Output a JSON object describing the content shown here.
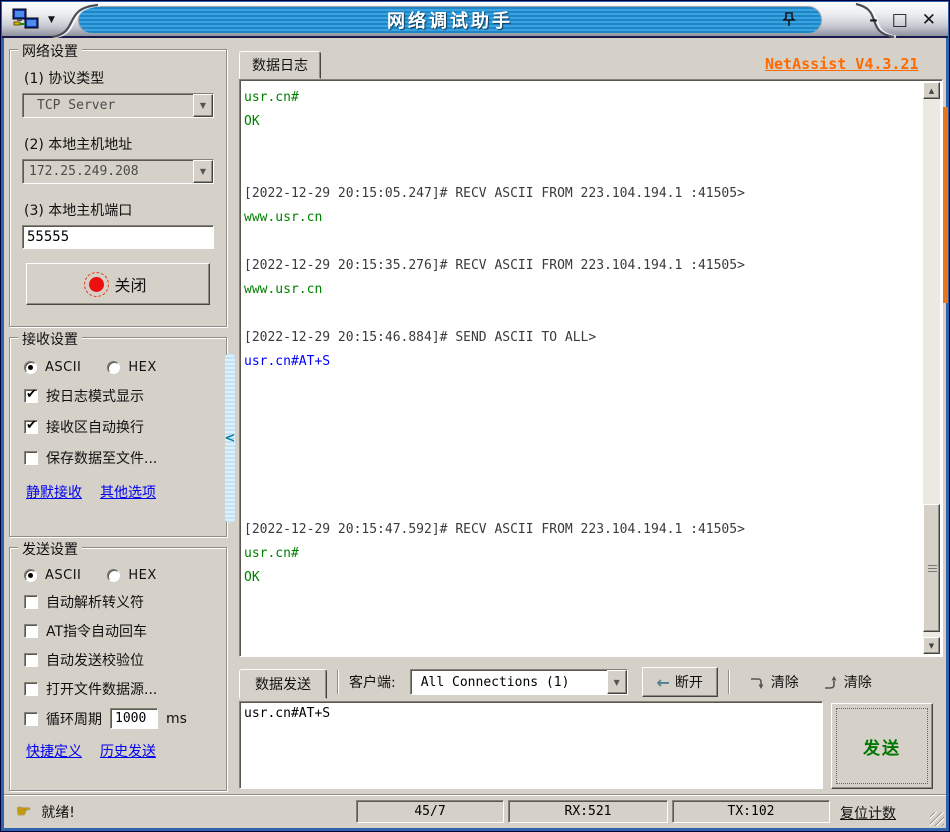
{
  "titlebar": {
    "title": "网络调试助手",
    "minimize": "–",
    "maximize": "□",
    "close": "✕",
    "menu_arrow": "▼"
  },
  "network_settings": {
    "title": "网络设置",
    "protocol_label": "(1) 协议类型",
    "protocol_value": "TCP Server",
    "host_label": "(2) 本地主机地址",
    "host_value": "172.25.249.208",
    "port_label": "(3) 本地主机端口",
    "port_value": "55555",
    "close_button_label": "关闭"
  },
  "receive_settings": {
    "title": "接收设置",
    "ascii_label": "ASCII",
    "hex_label": "HEX",
    "ascii_checked": true,
    "hex_checked": false,
    "options": [
      {
        "label": "按日志模式显示",
        "checked": true
      },
      {
        "label": "接收区自动换行",
        "checked": true
      },
      {
        "label": "保存数据至文件...",
        "checked": false
      }
    ],
    "link1": "静默接收",
    "link2": "其他选项"
  },
  "send_settings": {
    "title": "发送设置",
    "ascii_label": "ASCII",
    "hex_label": "HEX",
    "ascii_checked": true,
    "hex_checked": false,
    "options": [
      {
        "label": "自动解析转义符",
        "checked": false
      },
      {
        "label": "AT指令自动回车",
        "checked": false
      },
      {
        "label": "自动发送校验位",
        "checked": false
      },
      {
        "label": "打开文件数据源...",
        "checked": false
      }
    ],
    "cycle": {
      "label": "循环周期",
      "checked": false,
      "value": "1000",
      "unit": "ms"
    },
    "link1": "快捷定义",
    "link2": "历史发送"
  },
  "log_panel": {
    "tab_label": "数据日志",
    "version_link": "NetAssist V4.3.21",
    "lines": [
      {
        "text": "usr.cn#",
        "type": "recv"
      },
      {
        "text": "OK",
        "type": "recv"
      },
      {
        "text": "",
        "type": "blank"
      },
      {
        "text": "",
        "type": "blank"
      },
      {
        "text": "[2022-12-29 20:15:05.247]# RECV ASCII FROM 223.104.194.1 :41505>",
        "type": "meta"
      },
      {
        "text": "www.usr.cn",
        "type": "recv"
      },
      {
        "text": "",
        "type": "blank"
      },
      {
        "text": "[2022-12-29 20:15:35.276]# RECV ASCII FROM 223.104.194.1 :41505>",
        "type": "meta"
      },
      {
        "text": "www.usr.cn",
        "type": "recv"
      },
      {
        "text": "",
        "type": "blank"
      },
      {
        "text": "[2022-12-29 20:15:46.884]# SEND ASCII TO ALL>",
        "type": "meta"
      },
      {
        "text": "usr.cn#AT+S",
        "type": "send"
      },
      {
        "text": "",
        "type": "blank"
      },
      {
        "text": "",
        "type": "blank"
      },
      {
        "text": "",
        "type": "blank"
      },
      {
        "text": "",
        "type": "blank"
      },
      {
        "text": "",
        "type": "blank"
      },
      {
        "text": "",
        "type": "blank"
      },
      {
        "text": "[2022-12-29 20:15:47.592]# RECV ASCII FROM 223.104.194.1 :41505>",
        "type": "meta"
      },
      {
        "text": "usr.cn#",
        "type": "recv"
      },
      {
        "text": "OK",
        "type": "recv"
      }
    ]
  },
  "send_panel": {
    "tab_label": "数据发送",
    "client_label": "客户端:",
    "client_value": "All Connections (1)",
    "disconnect_label": "断开",
    "clear_recv_label": "清除",
    "clear_send_label": "清除",
    "input_value": "usr.cn#AT+S",
    "send_button_label": "发送"
  },
  "statusbar": {
    "ready_text": "就绪!",
    "frame_count": "45/7",
    "rx": "RX:521",
    "tx": "TX:102",
    "reset_label": "复位计数"
  },
  "colors": {
    "title_blue": "#2b97d8",
    "version_orange": "#ff6a00",
    "recv_green": "#008000",
    "send_blue": "#0000ff",
    "link_blue": "#0000f0",
    "indicator_red": "#ee1010",
    "send_button_green": "#007700"
  }
}
